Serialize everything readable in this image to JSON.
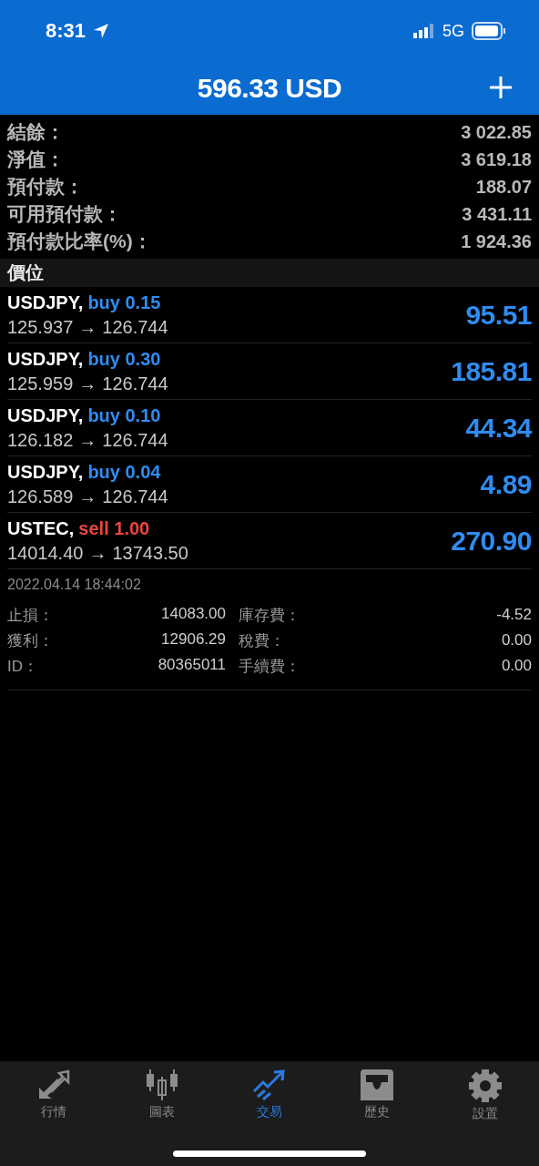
{
  "status_bar": {
    "time": "8:31",
    "network": "5G"
  },
  "header": {
    "title": "596.33 USD"
  },
  "summary": [
    {
      "label": "結餘：",
      "value": "3 022.85"
    },
    {
      "label": "淨值：",
      "value": "3 619.18"
    },
    {
      "label": "預付款：",
      "value": "188.07"
    },
    {
      "label": "可用預付款：",
      "value": "3 431.11"
    },
    {
      "label": "預付款比率(%)：",
      "value": "1 924.36"
    }
  ],
  "section": {
    "title": "價位"
  },
  "positions": [
    {
      "symbol": "USDJPY,",
      "kind": "buy",
      "order": "buy 0.15",
      "open": "125.937",
      "arrow": "→",
      "current": "126.744",
      "profit": "95.51"
    },
    {
      "symbol": "USDJPY,",
      "kind": "buy",
      "order": "buy 0.30",
      "open": "125.959",
      "arrow": "→",
      "current": "126.744",
      "profit": "185.81"
    },
    {
      "symbol": "USDJPY,",
      "kind": "buy",
      "order": "buy 0.10",
      "open": "126.182",
      "arrow": "→",
      "current": "126.744",
      "profit": "44.34"
    },
    {
      "symbol": "USDJPY,",
      "kind": "buy",
      "order": "buy 0.04",
      "open": "126.589",
      "arrow": "→",
      "current": "126.744",
      "profit": "4.89"
    },
    {
      "symbol": "USTEC,",
      "kind": "sell",
      "order": "sell 1.00",
      "open": "14014.40",
      "arrow": "→",
      "current": "13743.50",
      "profit": "270.90",
      "time": "2022.04.14 18:44:02",
      "details": [
        {
          "label": "止損：",
          "value": "14083.00",
          "label_2": "庫存費：",
          "value_2": "-4.52"
        },
        {
          "label": "獲利：",
          "value": "12906.29",
          "label_2": "稅費：",
          "value_2": "0.00"
        },
        {
          "label": "ID：",
          "value": "80365011",
          "label_2": "手續費：",
          "value_2": "0.00"
        }
      ]
    }
  ],
  "tab_bar": [
    {
      "kind": "quotes",
      "label": "行情",
      "selected": false
    },
    {
      "kind": "chart",
      "label": "圖表",
      "selected": false
    },
    {
      "kind": "trade",
      "label": "交易",
      "selected": true
    },
    {
      "kind": "history",
      "label": "歷史",
      "selected": false
    },
    {
      "kind": "settings",
      "label": "設置",
      "selected": false
    }
  ]
}
